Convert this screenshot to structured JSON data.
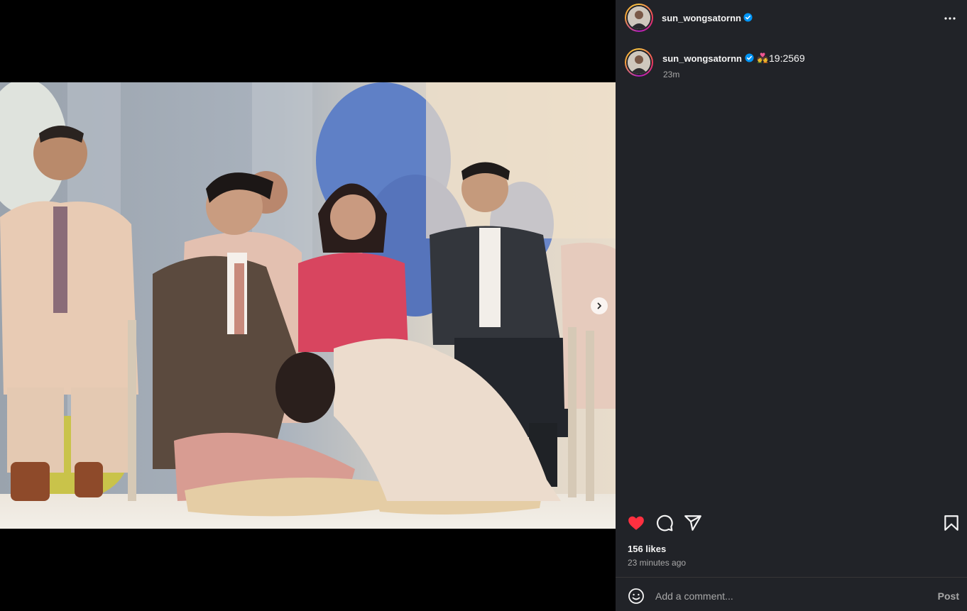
{
  "post": {
    "username": "sun_wongsatornn",
    "verified": true,
    "caption_emoji": "💑",
    "caption_text": "19:2569",
    "caption_age": "23m",
    "likes": "156 likes",
    "posted": "23 minutes ago"
  },
  "comment": {
    "placeholder": "Add a comment...",
    "post_label": "Post"
  },
  "icons": {
    "more": "more-options-icon",
    "like": "heart-filled-icon",
    "comment": "comment-icon",
    "share": "share-icon",
    "save": "bookmark-icon",
    "emoji": "emoji-icon",
    "next": "chevron-right-icon",
    "verified": "verified-badge-icon"
  },
  "colors": {
    "background": "#000000",
    "panel": "#212328",
    "like_red": "#ff3040",
    "verified_blue": "#0095f6",
    "muted_text": "#a8a8a8"
  }
}
